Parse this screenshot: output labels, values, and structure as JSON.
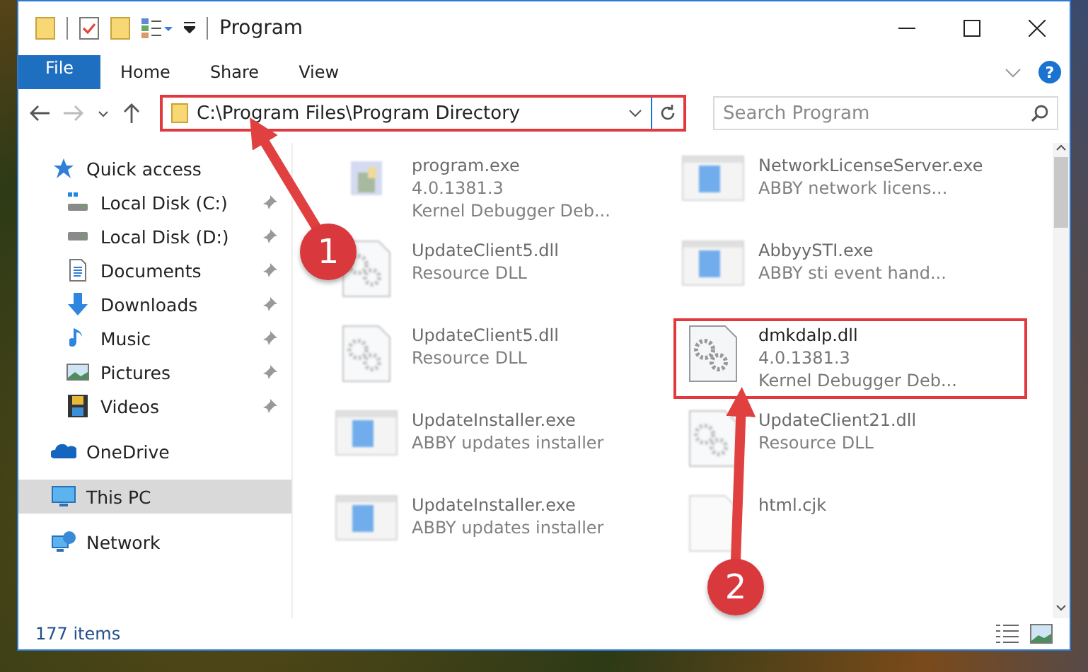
{
  "window": {
    "title": "Program"
  },
  "ribbon_tabs": [
    {
      "label": "File",
      "kind": "file"
    },
    {
      "label": "Home",
      "kind": "tab"
    },
    {
      "label": "Share",
      "kind": "tab"
    },
    {
      "label": "View",
      "kind": "tab"
    }
  ],
  "help": "?",
  "address_bar": {
    "path": "C:\\Program Files\\Program Directory",
    "highlighted": true
  },
  "search": {
    "placeholder": "Search Program"
  },
  "sidebar": {
    "items": [
      {
        "label": "Quick access",
        "kind": "star",
        "selected": false,
        "children": [
          {
            "label": "Local Disk (C:)",
            "kind": "disk-c",
            "pinned": true
          },
          {
            "label": "Local Disk (D:)",
            "kind": "disk",
            "pinned": true
          },
          {
            "label": "Documents",
            "kind": "doc",
            "pinned": true
          },
          {
            "label": "Downloads",
            "kind": "download",
            "pinned": true
          },
          {
            "label": "Music",
            "kind": "music",
            "pinned": true
          },
          {
            "label": "Pictures",
            "kind": "picture",
            "pinned": true
          },
          {
            "label": "Videos",
            "kind": "video",
            "pinned": true
          }
        ]
      },
      {
        "label": "OneDrive",
        "kind": "cloud",
        "selected": false
      },
      {
        "label": "This PC",
        "kind": "pc",
        "selected": true
      },
      {
        "label": "Network",
        "kind": "network",
        "selected": false
      }
    ]
  },
  "files": [
    {
      "name": "program.exe",
      "lines": [
        "4.0.1381.3",
        "Kernel Debugger Deb..."
      ],
      "kind": "exe",
      "blurred": true,
      "highlighted": false
    },
    {
      "name": "NetworkLicenseServer.exe",
      "lines": [
        "ABBY network licens..."
      ],
      "kind": "app",
      "blurred": true,
      "highlighted": false
    },
    {
      "name": "UpdateClient5.dll",
      "lines": [
        "Resource DLL"
      ],
      "kind": "dll",
      "blurred": true,
      "highlighted": false
    },
    {
      "name": "AbbyySTI.exe",
      "lines": [
        "ABBY sti event hand..."
      ],
      "kind": "app",
      "blurred": true,
      "highlighted": false
    },
    {
      "name": "UpdateClient5.dll",
      "lines": [
        "Resource DLL"
      ],
      "kind": "dll",
      "blurred": true,
      "highlighted": false
    },
    {
      "name": "dmkdalp.dll",
      "lines": [
        "4.0.1381.3",
        "Kernel Debugger Deb..."
      ],
      "kind": "dll",
      "blurred": false,
      "highlighted": true
    },
    {
      "name": "UpdateInstaller.exe",
      "lines": [
        "ABBY updates installer"
      ],
      "kind": "app",
      "blurred": true,
      "highlighted": false
    },
    {
      "name": "UpdateClient21.dll",
      "lines": [
        "Resource DLL"
      ],
      "kind": "dll",
      "blurred": true,
      "highlighted": false
    },
    {
      "name": "UpdateInstaller.exe",
      "lines": [
        "ABBY updates installer"
      ],
      "kind": "app",
      "blurred": true,
      "highlighted": false
    },
    {
      "name": "html.cjk",
      "kind": "blank",
      "blurred": true,
      "highlighted": false
    }
  ],
  "status_bar": {
    "count": "177 items"
  },
  "annotations": [
    {
      "number": "1"
    },
    {
      "number": "2"
    }
  ]
}
